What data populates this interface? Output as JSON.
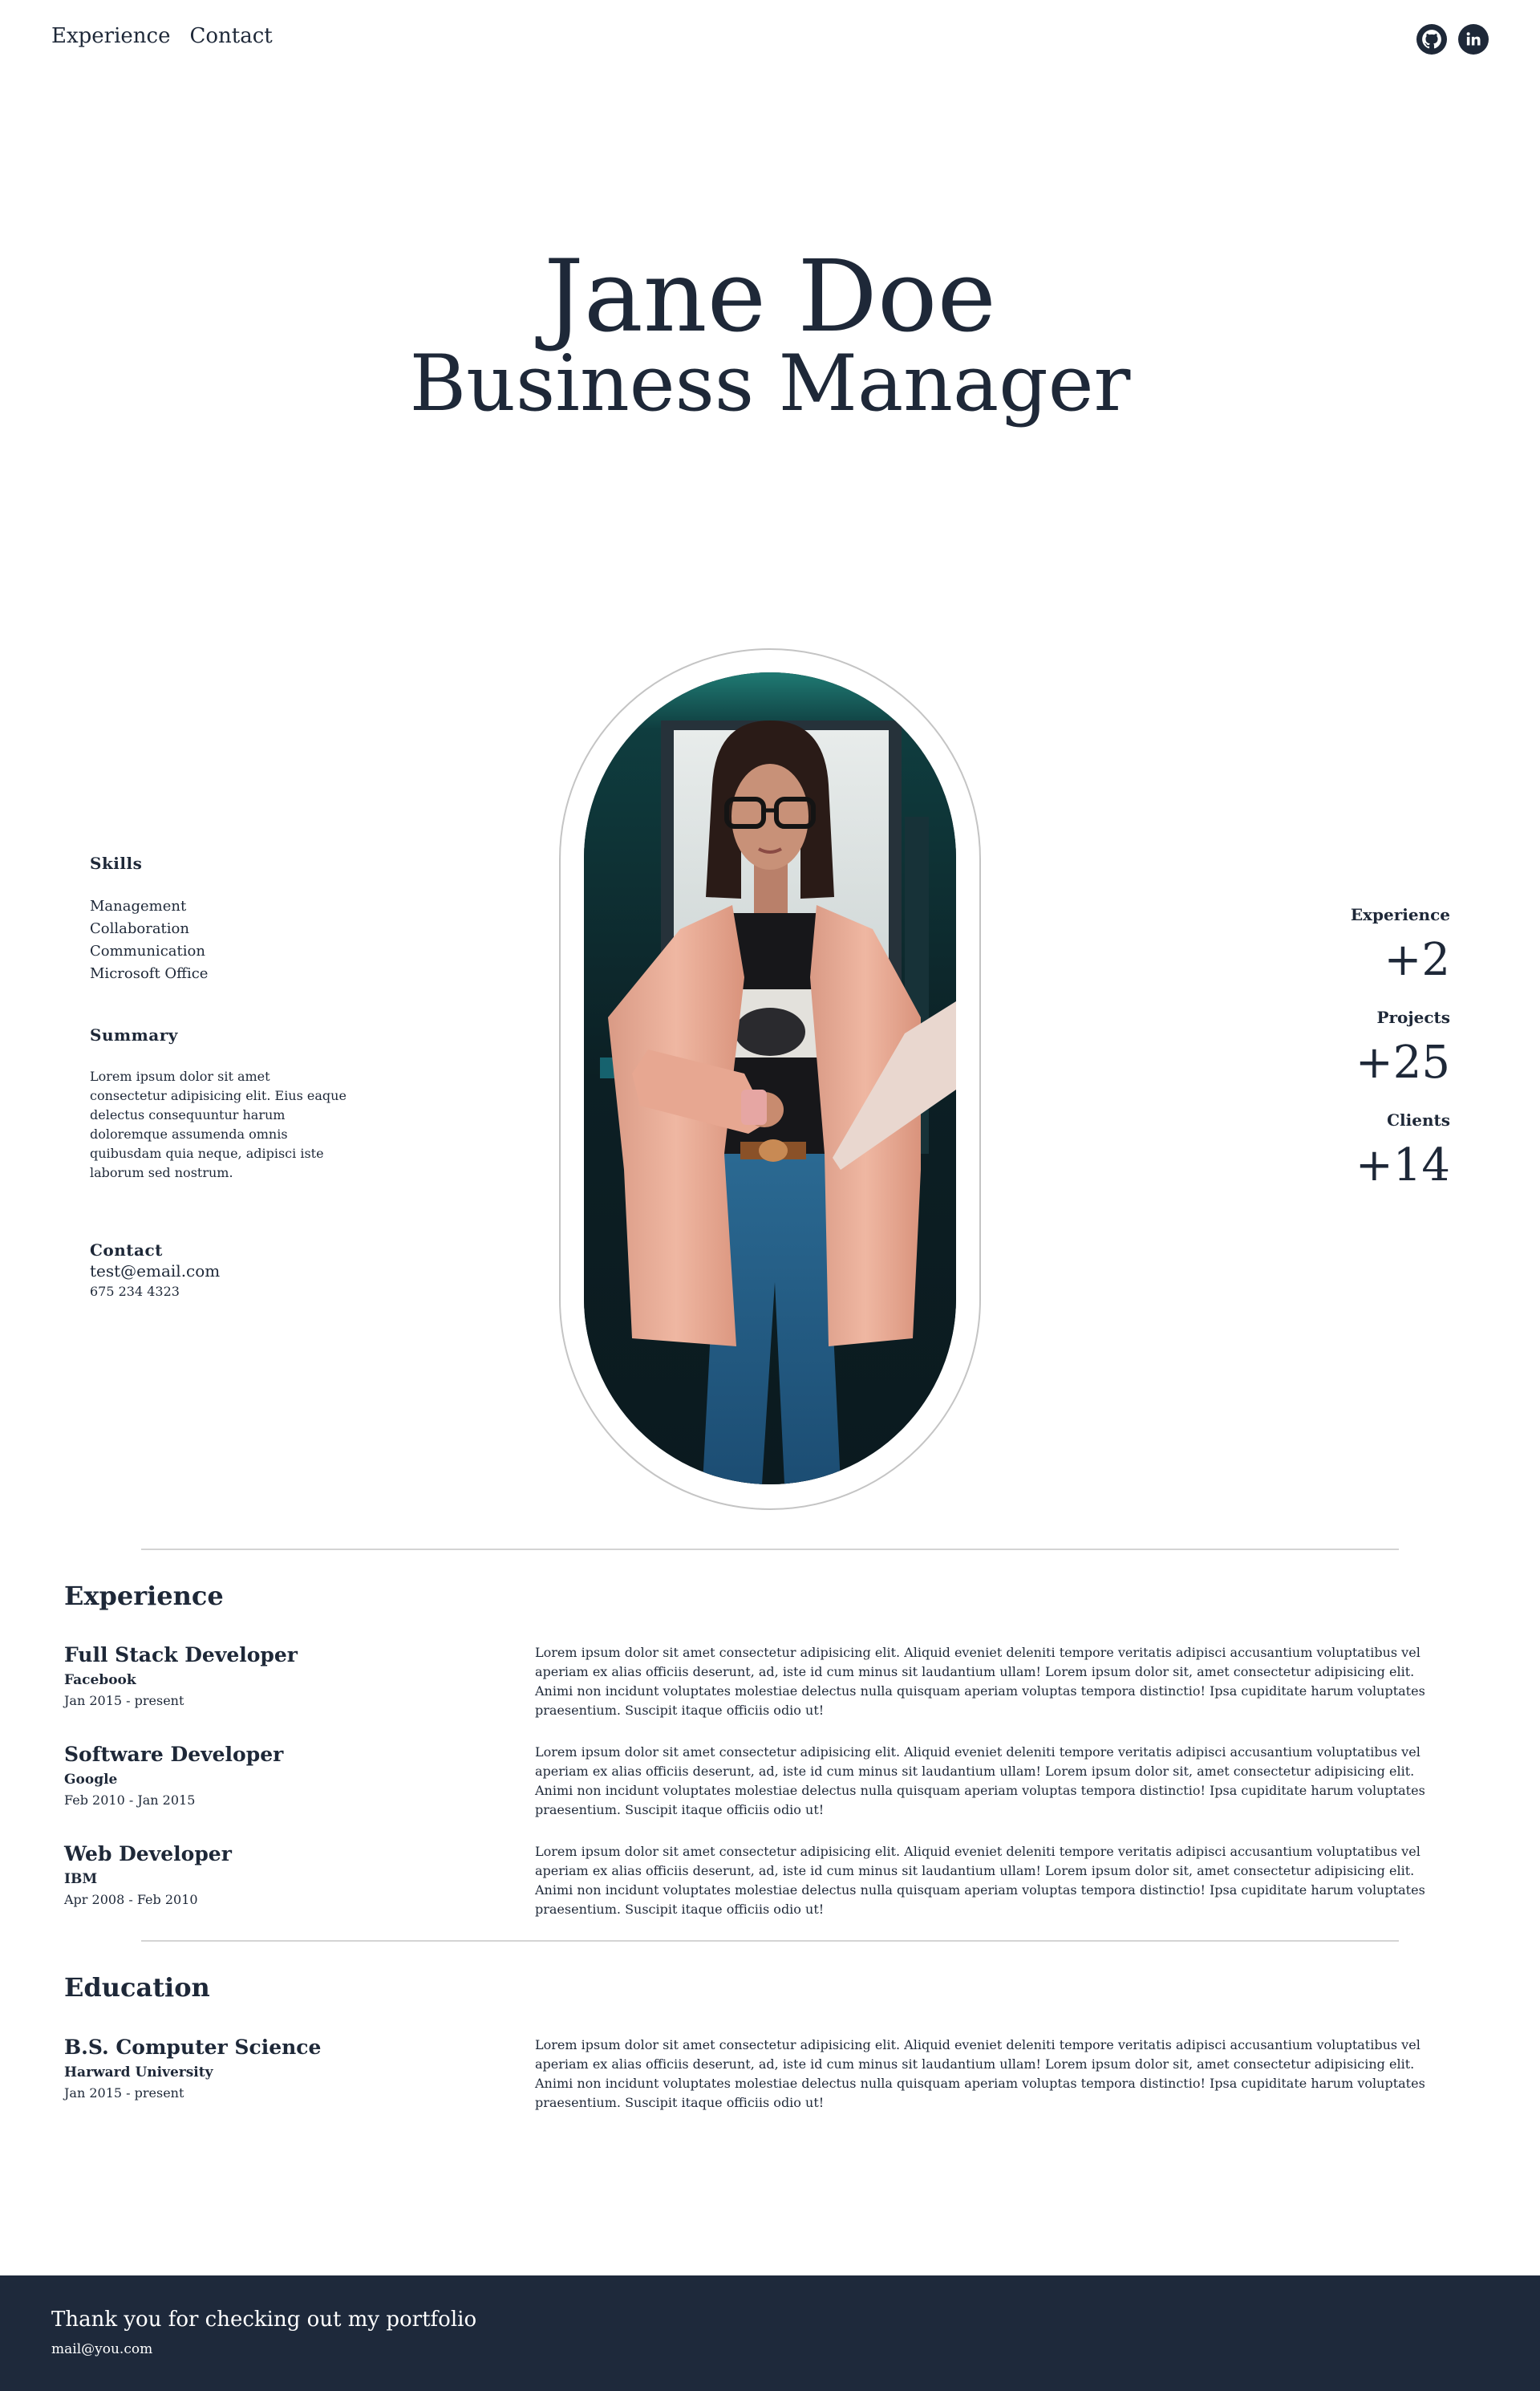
{
  "nav": {
    "links": [
      "Experience",
      "Contact"
    ],
    "social": [
      {
        "icon": "github-icon"
      },
      {
        "icon": "linkedin-icon"
      }
    ]
  },
  "hero": {
    "name": "Jane Doe",
    "role": "Business Manager"
  },
  "sidebar": {
    "skills_label": "Skills",
    "skills": [
      "Management",
      "Collaboration",
      "Communication",
      "Microsoft Office"
    ],
    "summary_label": "Summary",
    "summary": "Lorem ipsum dolor sit amet consectetur adipisicing elit. Eius eaque delectus consequuntur harum doloremque assumenda omnis quibusdam quia neque, adipisci iste laborum sed nostrum.",
    "contact_label": "Contact",
    "email": "test@email.com",
    "phone": "675 234 4323"
  },
  "stats": [
    {
      "label": "Experience",
      "value": "+2"
    },
    {
      "label": "Projects",
      "value": "+25"
    },
    {
      "label": "Clients",
      "value": "+14"
    }
  ],
  "experience": {
    "title": "Experience",
    "items": [
      {
        "role": "Full Stack Developer",
        "company": "Facebook",
        "dates": "Jan 2015 - present",
        "description": "Lorem ipsum dolor sit amet consectetur adipisicing elit. Aliquid eveniet deleniti tempore veritatis adipisci accusantium voluptatibus vel aperiam ex alias officiis deserunt, ad, iste id cum minus sit laudantium ullam! Lorem ipsum dolor sit, amet consectetur adipisicing elit. Animi non incidunt voluptates molestiae delectus nulla quisquam aperiam voluptas tempora distinctio! Ipsa cupiditate harum voluptates praesentium. Suscipit itaque officiis odio ut!"
      },
      {
        "role": "Software Developer",
        "company": "Google",
        "dates": "Feb 2010 - Jan 2015",
        "description": "Lorem ipsum dolor sit amet consectetur adipisicing elit. Aliquid eveniet deleniti tempore veritatis adipisci accusantium voluptatibus vel aperiam ex alias officiis deserunt, ad, iste id cum minus sit laudantium ullam! Lorem ipsum dolor sit, amet consectetur adipisicing elit. Animi non incidunt voluptates molestiae delectus nulla quisquam aperiam voluptas tempora distinctio! Ipsa cupiditate harum voluptates praesentium. Suscipit itaque officiis odio ut!"
      },
      {
        "role": "Web Developer",
        "company": "IBM",
        "dates": "Apr 2008 - Feb 2010",
        "description": "Lorem ipsum dolor sit amet consectetur adipisicing elit. Aliquid eveniet deleniti tempore veritatis adipisci accusantium voluptatibus vel aperiam ex alias officiis deserunt, ad, iste id cum minus sit laudantium ullam! Lorem ipsum dolor sit, amet consectetur adipisicing elit. Animi non incidunt voluptates molestiae delectus nulla quisquam aperiam voluptas tempora distinctio! Ipsa cupiditate harum voluptates praesentium. Suscipit itaque officiis odio ut!"
      }
    ]
  },
  "education": {
    "title": "Education",
    "items": [
      {
        "degree": "B.S. Computer Science",
        "school": "Harward University",
        "dates": "Jan 2015 - present",
        "description": "Lorem ipsum dolor sit amet consectetur adipisicing elit. Aliquid eveniet deleniti tempore veritatis adipisci accusantium voluptatibus vel aperiam ex alias officiis deserunt, ad, iste id cum minus sit laudantium ullam! Lorem ipsum dolor sit, amet consectetur adipisicing elit. Animi non incidunt voluptates molestiae delectus nulla quisquam aperiam voluptas tempora distinctio! Ipsa cupiditate harum voluptates praesentium. Suscipit itaque officiis odio ut!"
      }
    ]
  },
  "footer": {
    "message": "Thank you for checking out my portfolio",
    "email": "mail@you.com"
  },
  "colors": {
    "text": "#1e2838",
    "footer_bg": "#1e293b",
    "divider": "#d4d4d4",
    "portrait_frame": "#c4c4c4"
  }
}
